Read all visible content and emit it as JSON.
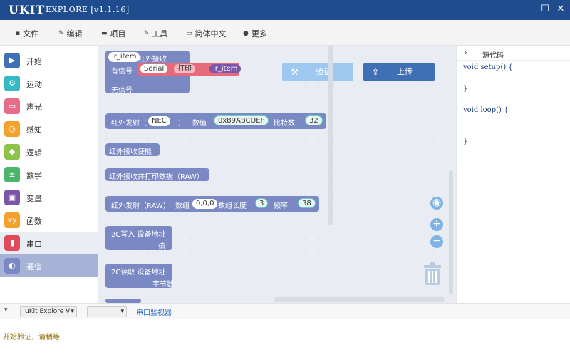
{
  "window": {
    "logo": "UKIT",
    "title": "EXPLORE [v1.1.16]",
    "controls": [
      "—",
      "☐",
      "✕"
    ]
  },
  "menu": [
    {
      "icon": "file-icon",
      "glyph": "▪",
      "label": "文件"
    },
    {
      "icon": "edit-icon",
      "glyph": "✎",
      "label": "编辑"
    },
    {
      "icon": "folder-icon",
      "glyph": "▬",
      "label": "项目"
    },
    {
      "icon": "wrench-icon",
      "glyph": "✎",
      "label": "工具"
    },
    {
      "icon": "keyboard-icon",
      "glyph": "▭",
      "label": "简体中文"
    },
    {
      "icon": "help-icon",
      "glyph": "●",
      "label": "更多"
    }
  ],
  "categories": [
    {
      "label": "开始",
      "color": "#3f6fb5",
      "glyph": "▶"
    },
    {
      "label": "运动",
      "color": "#35b9c3",
      "glyph": "⚙"
    },
    {
      "label": "声光",
      "color": "#e76c8a",
      "glyph": "▭"
    },
    {
      "label": "感知",
      "color": "#f2a12d",
      "glyph": "◎"
    },
    {
      "label": "逻辑",
      "color": "#8cc34a",
      "glyph": "◆"
    },
    {
      "label": "数学",
      "color": "#4db56a",
      "glyph": "±"
    },
    {
      "label": "变量",
      "color": "#7b55a8",
      "glyph": "▣"
    },
    {
      "label": "函数",
      "color": "#f2a12d",
      "glyph": "xy"
    },
    {
      "label": "串口",
      "color": "#e04b5c",
      "glyph": "▮"
    },
    {
      "label": "通信",
      "color": "#7a88c3",
      "glyph": "◐"
    }
  ],
  "active_category": 9,
  "blocks": {
    "ir_receive": {
      "var": "ir_item",
      "title": "红外接收",
      "has_signal": "有信号",
      "serial": "Serial",
      "print": "打印",
      "item": "ir_item",
      "no_signal": "无信号"
    },
    "ir_send": {
      "title": "红外发射（",
      "protocol": "NEC",
      "close": "）",
      "data_label": "数值",
      "data": "0x89ABCDEF",
      "bits_label": "比特数",
      "bits": "32"
    },
    "ir_enable": "红外接收使能",
    "ir_print_raw": "红外接收并打印数据（RAW）",
    "ir_send_raw": {
      "title": "红外发射（RAW）",
      "array_label": "数组",
      "array": "0,0,0",
      "len_label": "数组长度",
      "len": "3",
      "freq_label": "频率",
      "freq": "38"
    },
    "i2c_write": {
      "title": "I2C写入 设备地址",
      "value": "值"
    },
    "i2c_read": {
      "title": "I2C读取 设备地址",
      "bytes": "字节数"
    }
  },
  "actions": {
    "verify": "验证",
    "upload": "上传"
  },
  "code": {
    "header": "源代码",
    "lines": [
      "void setup() {",
      "",
      "}",
      "",
      "void loop() {",
      "",
      "",
      "",
      "}"
    ]
  },
  "console": {
    "board": "uKit Explore V",
    "port": "",
    "monitor": "串口监视器",
    "message": "开始验证，请稍等..."
  },
  "colors": {
    "titlebar": "#1e4c8e",
    "block": "#7a88c3",
    "verify": "#7fb3e6",
    "upload": "#3f6fb5",
    "message": "#8a6d00"
  }
}
